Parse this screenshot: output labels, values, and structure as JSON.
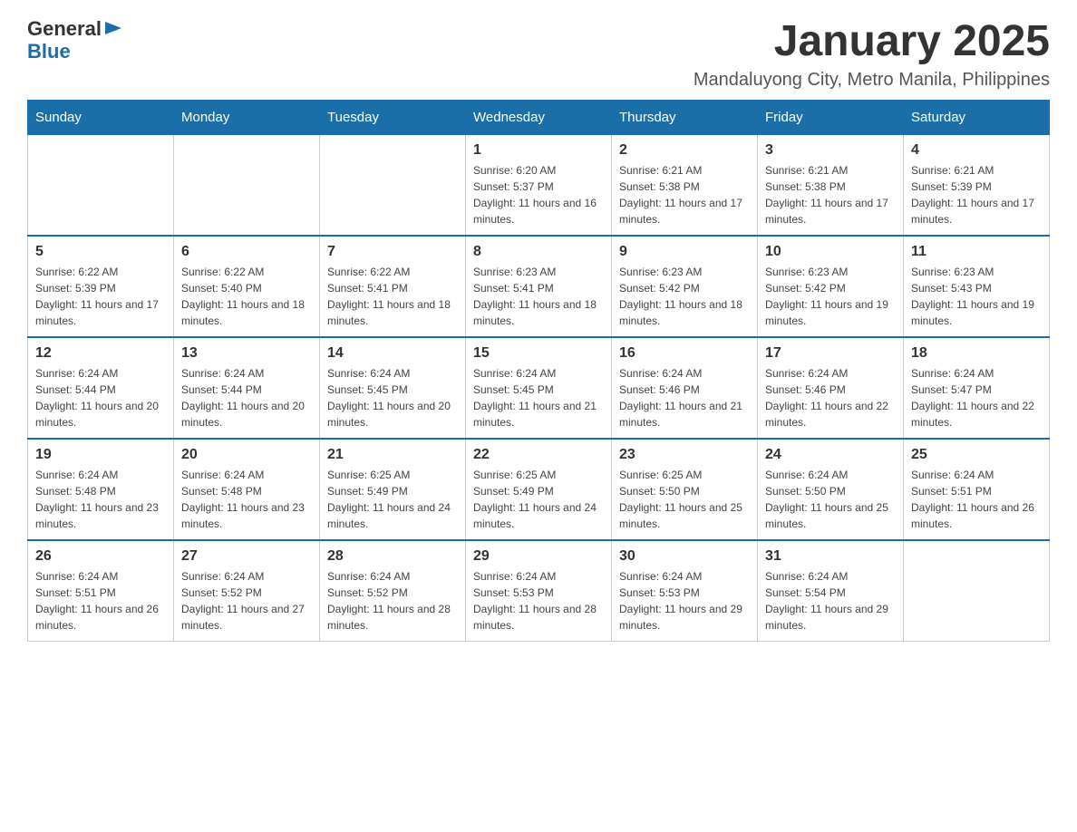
{
  "logo": {
    "general": "General",
    "blue": "Blue"
  },
  "header": {
    "month_year": "January 2025",
    "location": "Mandaluyong City, Metro Manila, Philippines"
  },
  "columns": [
    "Sunday",
    "Monday",
    "Tuesday",
    "Wednesday",
    "Thursday",
    "Friday",
    "Saturday"
  ],
  "weeks": [
    [
      {
        "day": "",
        "sunrise": "",
        "sunset": "",
        "daylight": ""
      },
      {
        "day": "",
        "sunrise": "",
        "sunset": "",
        "daylight": ""
      },
      {
        "day": "",
        "sunrise": "",
        "sunset": "",
        "daylight": ""
      },
      {
        "day": "1",
        "sunrise": "Sunrise: 6:20 AM",
        "sunset": "Sunset: 5:37 PM",
        "daylight": "Daylight: 11 hours and 16 minutes."
      },
      {
        "day": "2",
        "sunrise": "Sunrise: 6:21 AM",
        "sunset": "Sunset: 5:38 PM",
        "daylight": "Daylight: 11 hours and 17 minutes."
      },
      {
        "day": "3",
        "sunrise": "Sunrise: 6:21 AM",
        "sunset": "Sunset: 5:38 PM",
        "daylight": "Daylight: 11 hours and 17 minutes."
      },
      {
        "day": "4",
        "sunrise": "Sunrise: 6:21 AM",
        "sunset": "Sunset: 5:39 PM",
        "daylight": "Daylight: 11 hours and 17 minutes."
      }
    ],
    [
      {
        "day": "5",
        "sunrise": "Sunrise: 6:22 AM",
        "sunset": "Sunset: 5:39 PM",
        "daylight": "Daylight: 11 hours and 17 minutes."
      },
      {
        "day": "6",
        "sunrise": "Sunrise: 6:22 AM",
        "sunset": "Sunset: 5:40 PM",
        "daylight": "Daylight: 11 hours and 18 minutes."
      },
      {
        "day": "7",
        "sunrise": "Sunrise: 6:22 AM",
        "sunset": "Sunset: 5:41 PM",
        "daylight": "Daylight: 11 hours and 18 minutes."
      },
      {
        "day": "8",
        "sunrise": "Sunrise: 6:23 AM",
        "sunset": "Sunset: 5:41 PM",
        "daylight": "Daylight: 11 hours and 18 minutes."
      },
      {
        "day": "9",
        "sunrise": "Sunrise: 6:23 AM",
        "sunset": "Sunset: 5:42 PM",
        "daylight": "Daylight: 11 hours and 18 minutes."
      },
      {
        "day": "10",
        "sunrise": "Sunrise: 6:23 AM",
        "sunset": "Sunset: 5:42 PM",
        "daylight": "Daylight: 11 hours and 19 minutes."
      },
      {
        "day": "11",
        "sunrise": "Sunrise: 6:23 AM",
        "sunset": "Sunset: 5:43 PM",
        "daylight": "Daylight: 11 hours and 19 minutes."
      }
    ],
    [
      {
        "day": "12",
        "sunrise": "Sunrise: 6:24 AM",
        "sunset": "Sunset: 5:44 PM",
        "daylight": "Daylight: 11 hours and 20 minutes."
      },
      {
        "day": "13",
        "sunrise": "Sunrise: 6:24 AM",
        "sunset": "Sunset: 5:44 PM",
        "daylight": "Daylight: 11 hours and 20 minutes."
      },
      {
        "day": "14",
        "sunrise": "Sunrise: 6:24 AM",
        "sunset": "Sunset: 5:45 PM",
        "daylight": "Daylight: 11 hours and 20 minutes."
      },
      {
        "day": "15",
        "sunrise": "Sunrise: 6:24 AM",
        "sunset": "Sunset: 5:45 PM",
        "daylight": "Daylight: 11 hours and 21 minutes."
      },
      {
        "day": "16",
        "sunrise": "Sunrise: 6:24 AM",
        "sunset": "Sunset: 5:46 PM",
        "daylight": "Daylight: 11 hours and 21 minutes."
      },
      {
        "day": "17",
        "sunrise": "Sunrise: 6:24 AM",
        "sunset": "Sunset: 5:46 PM",
        "daylight": "Daylight: 11 hours and 22 minutes."
      },
      {
        "day": "18",
        "sunrise": "Sunrise: 6:24 AM",
        "sunset": "Sunset: 5:47 PM",
        "daylight": "Daylight: 11 hours and 22 minutes."
      }
    ],
    [
      {
        "day": "19",
        "sunrise": "Sunrise: 6:24 AM",
        "sunset": "Sunset: 5:48 PM",
        "daylight": "Daylight: 11 hours and 23 minutes."
      },
      {
        "day": "20",
        "sunrise": "Sunrise: 6:24 AM",
        "sunset": "Sunset: 5:48 PM",
        "daylight": "Daylight: 11 hours and 23 minutes."
      },
      {
        "day": "21",
        "sunrise": "Sunrise: 6:25 AM",
        "sunset": "Sunset: 5:49 PM",
        "daylight": "Daylight: 11 hours and 24 minutes."
      },
      {
        "day": "22",
        "sunrise": "Sunrise: 6:25 AM",
        "sunset": "Sunset: 5:49 PM",
        "daylight": "Daylight: 11 hours and 24 minutes."
      },
      {
        "day": "23",
        "sunrise": "Sunrise: 6:25 AM",
        "sunset": "Sunset: 5:50 PM",
        "daylight": "Daylight: 11 hours and 25 minutes."
      },
      {
        "day": "24",
        "sunrise": "Sunrise: 6:24 AM",
        "sunset": "Sunset: 5:50 PM",
        "daylight": "Daylight: 11 hours and 25 minutes."
      },
      {
        "day": "25",
        "sunrise": "Sunrise: 6:24 AM",
        "sunset": "Sunset: 5:51 PM",
        "daylight": "Daylight: 11 hours and 26 minutes."
      }
    ],
    [
      {
        "day": "26",
        "sunrise": "Sunrise: 6:24 AM",
        "sunset": "Sunset: 5:51 PM",
        "daylight": "Daylight: 11 hours and 26 minutes."
      },
      {
        "day": "27",
        "sunrise": "Sunrise: 6:24 AM",
        "sunset": "Sunset: 5:52 PM",
        "daylight": "Daylight: 11 hours and 27 minutes."
      },
      {
        "day": "28",
        "sunrise": "Sunrise: 6:24 AM",
        "sunset": "Sunset: 5:52 PM",
        "daylight": "Daylight: 11 hours and 28 minutes."
      },
      {
        "day": "29",
        "sunrise": "Sunrise: 6:24 AM",
        "sunset": "Sunset: 5:53 PM",
        "daylight": "Daylight: 11 hours and 28 minutes."
      },
      {
        "day": "30",
        "sunrise": "Sunrise: 6:24 AM",
        "sunset": "Sunset: 5:53 PM",
        "daylight": "Daylight: 11 hours and 29 minutes."
      },
      {
        "day": "31",
        "sunrise": "Sunrise: 6:24 AM",
        "sunset": "Sunset: 5:54 PM",
        "daylight": "Daylight: 11 hours and 29 minutes."
      },
      {
        "day": "",
        "sunrise": "",
        "sunset": "",
        "daylight": ""
      }
    ]
  ]
}
